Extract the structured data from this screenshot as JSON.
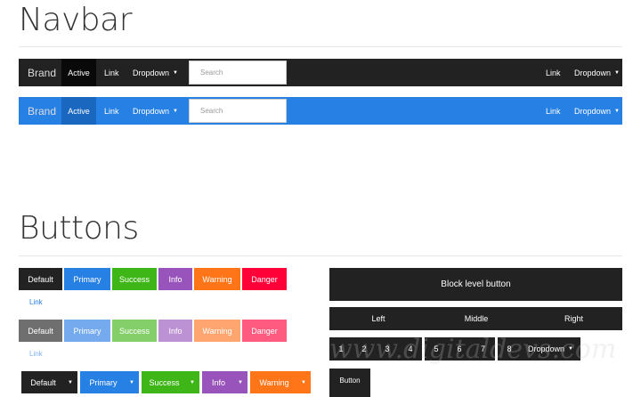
{
  "sections": {
    "navbar": "Navbar",
    "buttons": "Buttons"
  },
  "navbars": [
    {
      "bg": "#222222",
      "active_bg": "#090909",
      "brand": "Brand",
      "active": "Active",
      "link": "Link",
      "dropdown": "Dropdown",
      "search_placeholder": "Search",
      "right_link": "Link",
      "right_dropdown": "Dropdown"
    },
    {
      "bg": "#2780e3",
      "active_bg": "#1967be",
      "brand": "Brand",
      "active": "Active",
      "link": "Link",
      "dropdown": "Dropdown",
      "search_placeholder": "Search",
      "right_link": "Link",
      "right_dropdown": "Dropdown"
    }
  ],
  "buttons": {
    "row1": [
      {
        "label": "Default",
        "color": "#222222"
      },
      {
        "label": "Primary",
        "color": "#2780e3"
      },
      {
        "label": "Success",
        "color": "#3fb618"
      },
      {
        "label": "Info",
        "color": "#9954bb"
      },
      {
        "label": "Warning",
        "color": "#ff7518"
      },
      {
        "label": "Danger",
        "color": "#ff0039"
      }
    ],
    "row2": [
      {
        "label": "Default",
        "color": "#6f6f6f"
      },
      {
        "label": "Primary",
        "color": "#75aaef"
      },
      {
        "label": "Success",
        "color": "#85cf6b"
      },
      {
        "label": "Info",
        "color": "#bd92d4"
      },
      {
        "label": "Warning",
        "color": "#ffa670"
      },
      {
        "label": "Danger",
        "color": "#ff5a80"
      }
    ],
    "link": "Link",
    "row3": [
      {
        "label": "Default",
        "color": "#222222"
      },
      {
        "label": "Primary",
        "color": "#2780e3"
      },
      {
        "label": "Success",
        "color": "#3fb618"
      },
      {
        "label": "Info",
        "color": "#9954bb"
      },
      {
        "label": "Warning",
        "color": "#ff7518"
      }
    ],
    "block": "Block level button",
    "justified": [
      "Left",
      "Middle",
      "Right"
    ],
    "toolbar": {
      "g1": [
        "1",
        "2",
        "3",
        "4"
      ],
      "g2": [
        "5",
        "6",
        "7"
      ],
      "g3": [
        "8"
      ],
      "dropdown": "Dropdown"
    },
    "single": "Button"
  },
  "watermark": "www.digitaldevs.com"
}
